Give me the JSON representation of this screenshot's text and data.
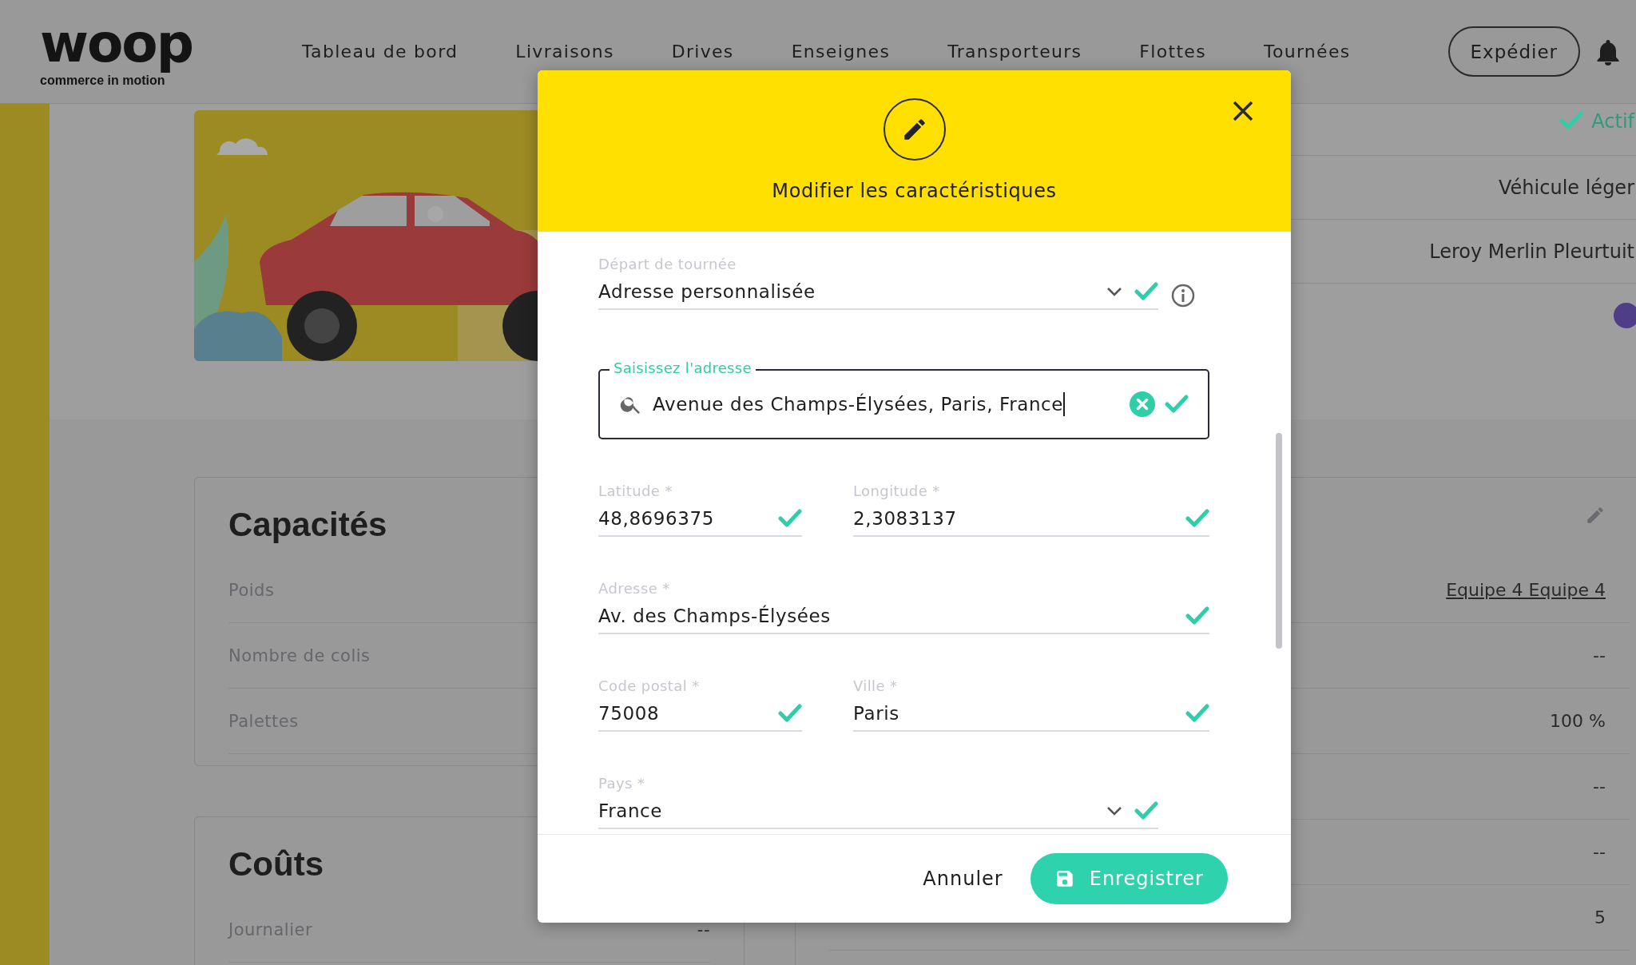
{
  "header": {
    "logo": {
      "wordmark": "woop",
      "tagline": "commerce in motion"
    },
    "nav": [
      "Tableau de bord",
      "Livraisons",
      "Drives",
      "Enseignes",
      "Transporteurs",
      "Flottes",
      "Tournées"
    ],
    "ship_button": "Expédier"
  },
  "vehicle": {
    "status": "Actif",
    "rows": [
      "Véhicule léger",
      "Leroy Merlin Pleurtuit"
    ]
  },
  "capacities": {
    "title": "Capacités",
    "rows": [
      "Poids",
      "Nombre de colis",
      "Palettes"
    ]
  },
  "team_card": {
    "rows": [
      {
        "kind": "link",
        "value": "Equipe 4 Equipe 4"
      },
      {
        "kind": "text",
        "value": "--"
      },
      {
        "kind": "text",
        "value": "100 %"
      },
      {
        "kind": "text",
        "value": "--"
      },
      {
        "kind": "text",
        "value": "--"
      },
      {
        "kind": "text",
        "value": "5"
      }
    ]
  },
  "costs": {
    "title": "Coûts",
    "rows": [
      {
        "label": "Journalier",
        "value": "--"
      }
    ]
  },
  "modal": {
    "title": "Modifier les caractéristiques",
    "fields": [
      {
        "kind": "select",
        "label": "Départ de tournée",
        "value": "Adresse personnalisée",
        "valid": true,
        "info": true
      },
      {
        "kind": "search",
        "label": "Saisissez l'adresse",
        "value": "Avenue des Champs-Élysées, Paris, France",
        "valid": true,
        "focused": true
      },
      {
        "kind": "pair",
        "items": [
          {
            "label": "Latitude *",
            "value": "48,8696375",
            "valid": true
          },
          {
            "label": "Longitude *",
            "value": "2,3083137",
            "valid": true
          }
        ]
      },
      {
        "kind": "text",
        "label": "Adresse *",
        "value": "Av. des Champs-Élysées",
        "valid": true
      },
      {
        "kind": "pair",
        "items": [
          {
            "label": "Code postal *",
            "value": "75008",
            "valid": true
          },
          {
            "label": "Ville *",
            "value": "Paris",
            "valid": true
          }
        ]
      },
      {
        "kind": "select",
        "label": "Pays *",
        "value": "France",
        "valid": true,
        "info": false
      }
    ],
    "cancel_button": "Annuler",
    "save_button": "Enregistrer"
  }
}
